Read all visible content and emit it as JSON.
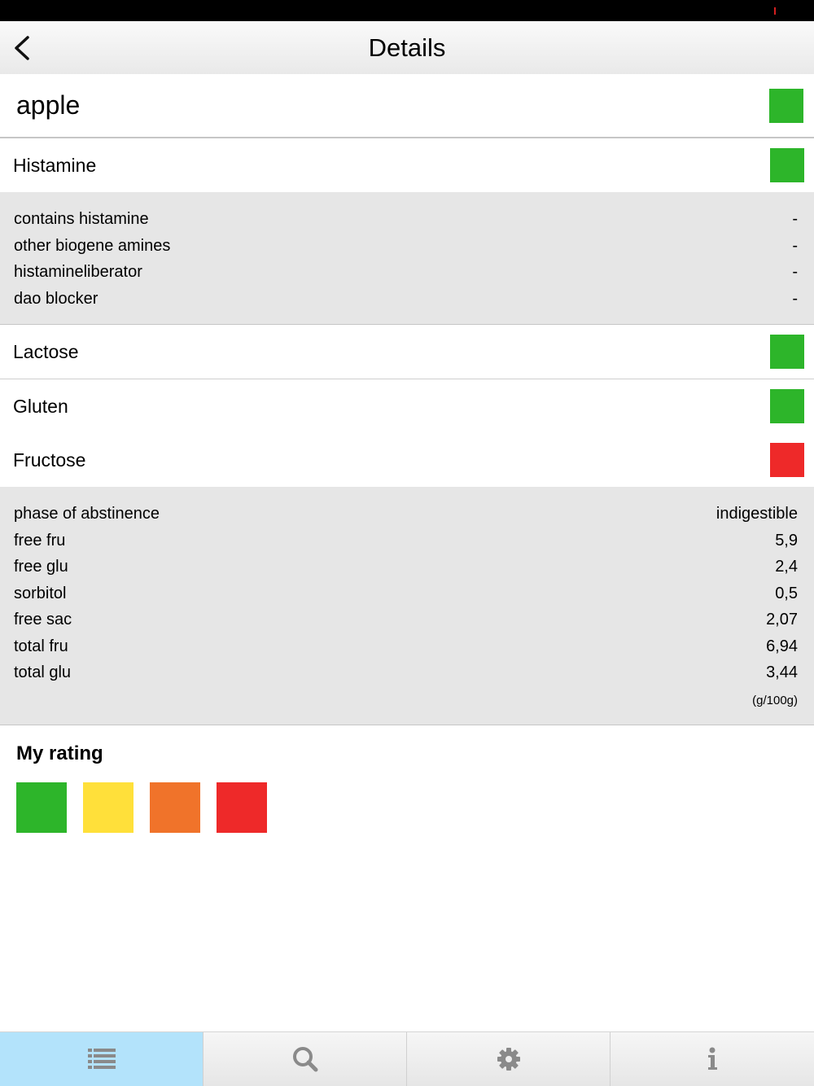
{
  "nav": {
    "title": "Details"
  },
  "food": {
    "name": "apple",
    "status_color": "#2db52a"
  },
  "colors": {
    "green": "#2db52a",
    "yellow": "#ffe03a",
    "orange": "#f0732a",
    "red": "#ee2929",
    "detail_bg": "#e6e6e6",
    "tab_active": "#b3e3fb",
    "icon_gray": "#8e8e8e"
  },
  "categories": {
    "histamine": {
      "label": "Histamine",
      "status_color": "#2db52a",
      "details": [
        {
          "label": "contains histamine",
          "value": "-"
        },
        {
          "label": "other biogene amines",
          "value": "-"
        },
        {
          "label": "histamineliberator",
          "value": "-"
        },
        {
          "label": "dao blocker",
          "value": "-"
        }
      ]
    },
    "lactose": {
      "label": "Lactose",
      "status_color": "#2db52a"
    },
    "gluten": {
      "label": "Gluten",
      "status_color": "#2db52a"
    },
    "fructose": {
      "label": "Fructose",
      "status_color": "#ee2929",
      "details": [
        {
          "label": "phase of abstinence",
          "value": "indigestible"
        },
        {
          "label": "free fru",
          "value": "5,9"
        },
        {
          "label": "free glu",
          "value": "2,4"
        },
        {
          "label": "sorbitol",
          "value": "0,5"
        },
        {
          "label": "free sac",
          "value": "2,07"
        },
        {
          "label": "total fru",
          "value": "6,94"
        },
        {
          "label": "total glu",
          "value": "3,44"
        }
      ],
      "unit": "(g/100g)"
    }
  },
  "rating": {
    "title": "My rating",
    "options": [
      "#2db52a",
      "#ffe03a",
      "#f0732a",
      "#ee2929"
    ]
  },
  "tabs": [
    {
      "icon": "list-icon",
      "active": true
    },
    {
      "icon": "search-icon",
      "active": false
    },
    {
      "icon": "gear-icon",
      "active": false
    },
    {
      "icon": "info-icon",
      "active": false
    }
  ]
}
